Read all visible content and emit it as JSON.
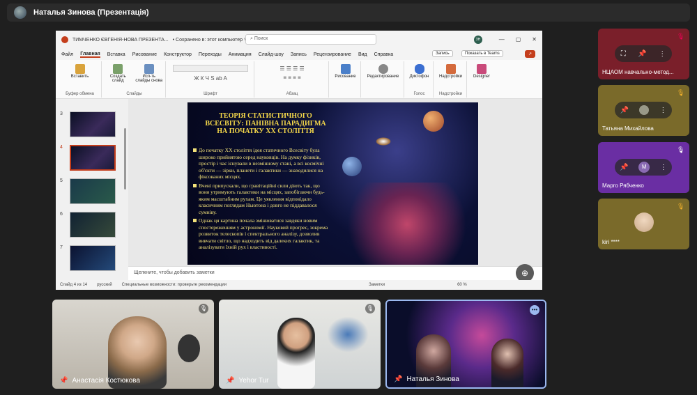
{
  "meeting": {
    "presenter_title": "Наталья Зинова (Презентація)"
  },
  "ppt": {
    "file_title": "ТИМЧЕНКО ЄВГЕНІЯ-НОВА ПРЕЗЕНТА...",
    "saved": "• Сохранено в: этот компьютер ˅",
    "search_placeholder": "Поиск",
    "user_initials": "ЗН",
    "menu": [
      "Файл",
      "Главная",
      "Вставка",
      "Рисование",
      "Конструктор",
      "Переходы",
      "Анимация",
      "Слайд-шоу",
      "Запись",
      "Рецензирование",
      "Вид",
      "Справка"
    ],
    "record_btn": "Запись",
    "teams_btn": "Показать в Teams",
    "ribbon_groups": [
      "Буфер обмена",
      "Слайды",
      "Шрифт",
      "Абзац",
      "Рисование",
      "Редактирование",
      "Диктофон",
      "Надстройки",
      "Designer"
    ],
    "ribbon_bottom_labels": [
      "Буфер обмена",
      "Слайды",
      "Шрифт",
      "Абзац",
      "Голос",
      "Надстройки"
    ],
    "ribbon_items": [
      "Вставить",
      "Создать слайд",
      "Исп-ть слайды снова"
    ],
    "thumb_numbers": [
      "3",
      "4",
      "5",
      "6",
      "7"
    ],
    "notes_placeholder": "Щелкните, чтобы добавить заметки",
    "status_slide": "Слайд 4 из 14",
    "status_lang": "русский",
    "status_access": "Специальные возможности: проверьте рекомендации",
    "status_notes": "Заметки",
    "status_zoom": "60 %"
  },
  "slide": {
    "title": "ТЕОРІЯ СТАТИСТИЧНОГО ВСЕСВІТУ: ПАНІВНА ПАРАДИГМА НА ПОЧАТКУ XX СТОЛІТТЯ",
    "p1": "До початку XX століття ідея статичного Всесвіту була широко прийнятою серед науковців. На думку фізиків, простір і час існували в незмінному стані, а всі космічні об'єкти — зірки, планети і галактики — знаходилися на фіксованих місцях.",
    "p2": "Вчені припускали, що гравітаційні сили діють так, що вони утримують галактики на місцях, запобігаючи будь-яким масштабним рухам. Це уявлення відповідало класичним поглядам Ньютона і довго не піддавалося сумніву.",
    "p3": "Однак ця картина почала змінюватися завдяки новим спостереженням у астрономії. Науковий прогрес, зокрема розвиток телескопів і спектрального аналізу, дозволив вивчати світло, що надходить від далеких галактик, та аналізувати їхній рух і властивості."
  },
  "participants_side": [
    {
      "name": "НЦАОМ навчально-метод...",
      "color": "#7a1f2a"
    },
    {
      "name": "Татьяна Михайлова",
      "color": "#7a6a2a"
    },
    {
      "name": "Марго Рябченко",
      "color": "#6a2ea3"
    },
    {
      "name": "kiri ****",
      "color": "#7a6a2a"
    }
  ],
  "participants_bottom": [
    {
      "name": "Анастасія Костюкова"
    },
    {
      "name": "Yehor Tur"
    },
    {
      "name": "Наталья Зинова"
    }
  ],
  "colors": {
    "accent": "#c43e1c",
    "slide_text": "#f3e27a",
    "active_border": "#9bb8f0"
  }
}
